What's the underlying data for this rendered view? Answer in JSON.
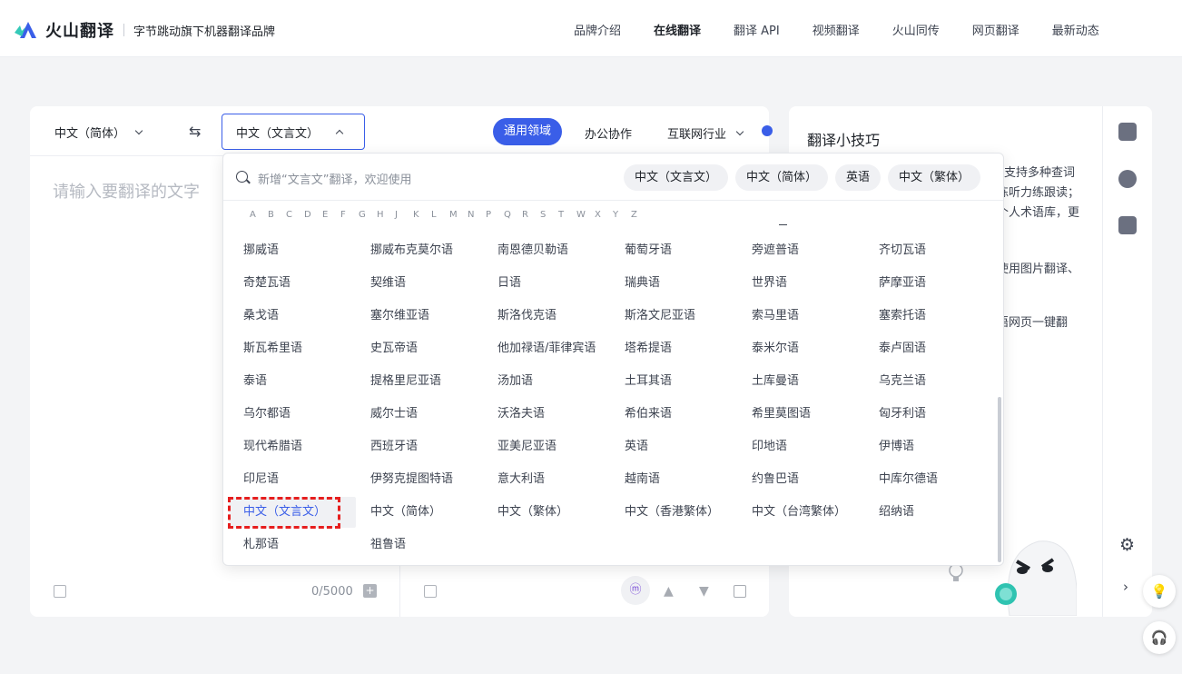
{
  "header": {
    "brand": "火山翻译",
    "subtitle": "字节跳动旗下机器翻译品牌",
    "nav": [
      "品牌介绍",
      "在线翻译",
      "翻译 API",
      "视频翻译",
      "火山同传",
      "网页翻译",
      "最新动态"
    ],
    "active_nav": "在线翻译"
  },
  "toolbar": {
    "source_lang": "中文（简体）",
    "target_lang": "中文（文言文）",
    "domain_active": "通用领域",
    "domain_office": "办公协作",
    "domain_internet": "互联网行业"
  },
  "editor": {
    "placeholder": "请输入要翻译的文字",
    "counter": "0/5000"
  },
  "dropdown": {
    "search_placeholder": "新增“文言文”翻译，欢迎使用",
    "recent_chips": [
      "中文（文言文）",
      "中文（简体）",
      "英语",
      "中文（繁体）"
    ],
    "alphabet": [
      "A",
      "B",
      "C",
      "D",
      "E",
      "F",
      "G",
      "H",
      "J",
      "K",
      "L",
      "M",
      "N",
      "P",
      "Q",
      "R",
      "S",
      "T",
      "W",
      "X",
      "Y",
      "Z"
    ],
    "languages": [
      [
        "挪威语",
        "挪威布克莫尔语",
        "南恩德贝勒语",
        "葡萄牙语",
        "旁遮普语",
        "齐切瓦语"
      ],
      [
        "奇楚瓦语",
        "契维语",
        "日语",
        "瑞典语",
        "世界语",
        "萨摩亚语"
      ],
      [
        "桑戈语",
        "塞尔维亚语",
        "斯洛伐克语",
        "斯洛文尼亚语",
        "索马里语",
        "塞索托语"
      ],
      [
        "斯瓦希里语",
        "史瓦帝语",
        "他加禄语/菲律宾语",
        "塔希提语",
        "泰米尔语",
        "泰卢固语"
      ],
      [
        "泰语",
        "提格里尼亚语",
        "汤加语",
        "土耳其语",
        "土库曼语",
        "乌克兰语"
      ],
      [
        "乌尔都语",
        "威尔士语",
        "沃洛夫语",
        "希伯来语",
        "希里莫图语",
        "匈牙利语"
      ],
      [
        "现代希腊语",
        "西班牙语",
        "亚美尼亚语",
        "英语",
        "印地语",
        "伊博语"
      ],
      [
        "印尼语",
        "伊努克提图特语",
        "意大利语",
        "越南语",
        "约鲁巴语",
        "中库尔德语"
      ],
      [
        "中文（文言文）",
        "中文（简体）",
        "中文（繁体）",
        "中文（香港繁体）",
        "中文（台湾繁体）",
        "绍纳语"
      ],
      [
        "札那语",
        "祖鲁语"
      ]
    ],
    "selected": "中文（文言文）"
  },
  "tips": {
    "title": "翻译小技巧",
    "lines": [
      "支持多种查词",
      "练听力练跟读；",
      "个人术语库，更",
      "使用图片翻译、",
      "语网页一键翻"
    ]
  },
  "colors": {
    "accent": "#3a5ee8",
    "highlight": "#e61e1e"
  }
}
